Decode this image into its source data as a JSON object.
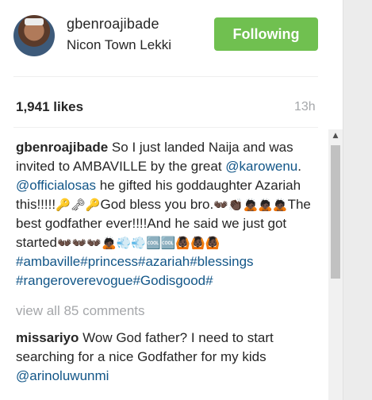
{
  "post": {
    "username": "gbenroajibade",
    "location": "Nicon Town Lekki",
    "follow_label": "Following",
    "likes": "1,941 likes",
    "time": "13h",
    "colors": {
      "follow": "#70c050",
      "link": "#125688",
      "muted": "#a5a7aa"
    }
  },
  "caption": {
    "author": "gbenroajibade",
    "part1": "So I just landed Naija and was invited to AMBAVILLE by the great",
    "mention1": "@karowenu",
    "part2": ".",
    "mention2": "@officialosas",
    "part3": "he gifted his goddaughter Azariah this!!!!!",
    "emoji1": "🔑🗝🔑",
    "part4": "God bless you bro.",
    "emoji2": "👐🏿👏🏿🙇🏿🙇🏿🙇🏿",
    "part5": "The best godfather ever!!!!And he said we just got started",
    "emoji3": "👐🏿👐🏿👐🏿🙇🏿💨💨🆒🆒🙆🏿🙆🏿🙆🏿",
    "hashtags": "#ambaville#princess#azariah#blessings #rangeroverevogue#Godisgood#"
  },
  "view_all": "view all 85 comments",
  "comment": {
    "author": "missariyo",
    "text": "Wow God father? I need to start searching for a nice Godfather for my kids",
    "mention": "@arinoluwunmi"
  }
}
